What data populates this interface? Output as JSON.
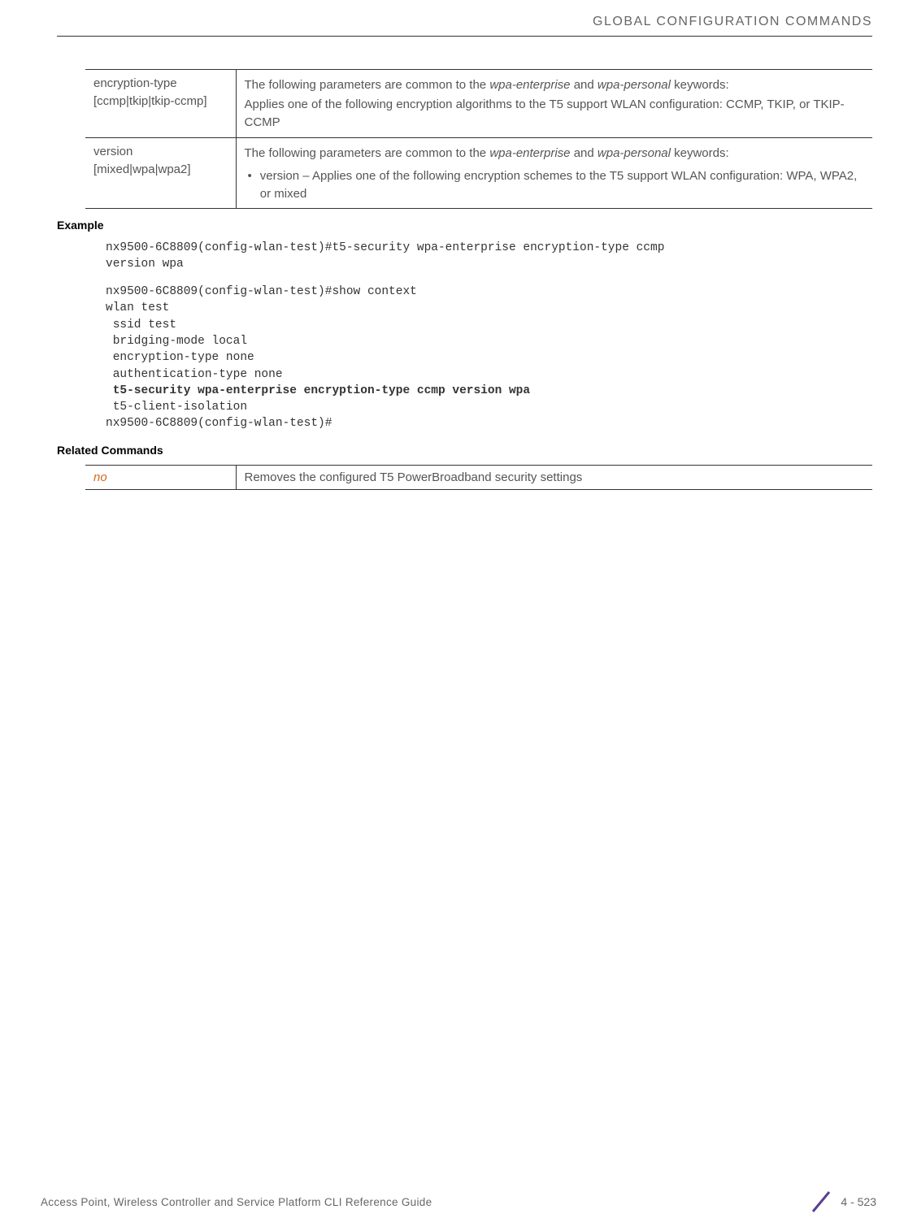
{
  "header": {
    "title": "GLOBAL CONFIGURATION COMMANDS"
  },
  "tables": {
    "params": [
      {
        "col1_line1": "encryption-type",
        "col1_line2": "[ccmp|tkip|tkip-ccmp]",
        "col2_intro_a": "The following parameters are common to the ",
        "col2_intro_b": "wpa-enterprise",
        "col2_intro_c": " and ",
        "col2_intro_d": "wpa-personal",
        "col2_intro_e": " keywords:",
        "col2_body": "Applies one of the following encryption algorithms to the T5 support WLAN configuration: CCMP, TKIP, or TKIP-CCMP"
      },
      {
        "col1_line1": "version",
        "col1_line2": "[mixed|wpa|wpa2]",
        "col2_intro_a": "The following parameters are common to the ",
        "col2_intro_b": "wpa-enterprise",
        "col2_intro_c": " and ",
        "col2_intro_d": "wpa-personal",
        "col2_intro_e": " keywords:",
        "col2_bullet": "version – Applies one of the following encryption schemes to the T5 support WLAN configuration: WPA, WPA2, or mixed"
      }
    ],
    "related": {
      "col1": "no",
      "col2": "Removes the configured T5 PowerBroadband security settings"
    }
  },
  "sections": {
    "example_heading": "Example",
    "related_heading": "Related Commands"
  },
  "code": {
    "block1": "nx9500-6C8809(config-wlan-test)#t5-security wpa-enterprise encryption-type ccmp \nversion wpa",
    "block2_pre": "nx9500-6C8809(config-wlan-test)#show context\nwlan test\n ssid test\n bridging-mode local\n encryption-type none\n authentication-type none\n ",
    "block2_bold": "t5-security wpa-enterprise encryption-type ccmp version wpa",
    "block2_post": "\n t5-client-isolation\nnx9500-6C8809(config-wlan-test)#"
  },
  "footer": {
    "text": "Access Point, Wireless Controller and Service Platform CLI Reference Guide",
    "page": "4 - 523"
  }
}
